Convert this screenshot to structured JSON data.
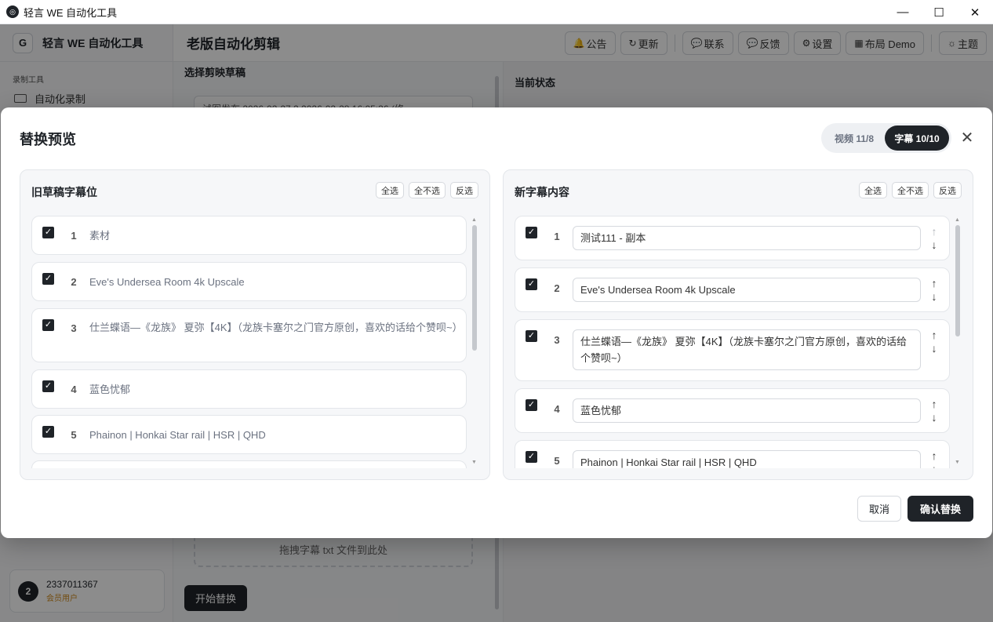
{
  "window": {
    "title": "轻言 WE 自动化工具",
    "controls": {
      "minimize": "—",
      "maximize": "☐",
      "close": "✕"
    }
  },
  "sidebar": {
    "brand": "轻言 WE 自动化工具",
    "brand_logo": "G",
    "section": "录制工具",
    "items": [
      {
        "label": "自动化录制",
        "icon": "video-icon"
      }
    ],
    "user": {
      "avatar": "2",
      "id": "2337011367",
      "role": "会员用户"
    }
  },
  "header": {
    "title": "老版自动化剪辑",
    "actions": [
      {
        "label": "公告",
        "icon": "bell-icon",
        "glyph": "🔔"
      },
      {
        "label": "更新",
        "icon": "refresh-icon",
        "glyph": "↻"
      },
      {
        "label": "联系",
        "icon": "chat-icon",
        "glyph": "💬"
      },
      {
        "label": "反馈",
        "icon": "feedback-icon",
        "glyph": "💬"
      },
      {
        "label": "设置",
        "icon": "gear-icon",
        "glyph": "⚙"
      },
      {
        "label": "布局 Demo",
        "icon": "layout-icon",
        "glyph": "▦"
      },
      {
        "label": "主题",
        "icon": "sun-icon",
        "glyph": "☼"
      }
    ]
  },
  "left_panel": {
    "label": "选择剪映草稿",
    "draft_value": "试图发布 2026-02-27 2 2026-02-28 16:05:36 (修",
    "drop_zone": "拖拽字幕 txt 文件到此处",
    "start_button": "开始替换"
  },
  "right_panel": {
    "label": "当前状态"
  },
  "modal": {
    "title": "替换预览",
    "tabs": [
      {
        "label": "视频 11/8",
        "active": false
      },
      {
        "label": "字幕 10/10",
        "active": true
      }
    ],
    "close": "✕",
    "old_card": {
      "title": "旧草稿字幕位",
      "actions": [
        "全选",
        "全不选",
        "反选"
      ],
      "items": [
        {
          "index": "1",
          "text": "素材",
          "checked": true
        },
        {
          "index": "2",
          "text": "Eve's Undersea Room 4k Upscale",
          "checked": true
        },
        {
          "index": "3",
          "text": "仕兰蝶语—《龙族》 夏弥【4K】（龙族卡塞尔之门官方原创，喜欢的话给个赞呗~）",
          "checked": true
        },
        {
          "index": "4",
          "text": "蓝色忧郁",
          "checked": true
        },
        {
          "index": "5",
          "text": "Phainon | Honkai Star rail | HSR | QHD",
          "checked": true
        }
      ]
    },
    "new_card": {
      "title": "新字幕内容",
      "actions": [
        "全选",
        "全不选",
        "反选"
      ],
      "items": [
        {
          "index": "1",
          "text": "测试111 - 副本",
          "checked": true
        },
        {
          "index": "2",
          "text": "Eve's Undersea Room 4k Upscale",
          "checked": true
        },
        {
          "index": "3",
          "text": "仕兰蝶语—《龙族》 夏弥【4K】（龙族卡塞尔之门官方原创，喜欢的话给个赞呗~）",
          "checked": true
        },
        {
          "index": "4",
          "text": "蓝色忧郁",
          "checked": true
        },
        {
          "index": "5",
          "text": "Phainon | Honkai Star rail | HSR | QHD",
          "checked": true
        }
      ]
    },
    "cancel": "取消",
    "confirm": "确认替换"
  },
  "glyphs": {
    "check": "✓",
    "up": "↑",
    "down": "↓"
  },
  "colors": {
    "accent": "#1f2328",
    "member_role": "#d08a1c"
  }
}
